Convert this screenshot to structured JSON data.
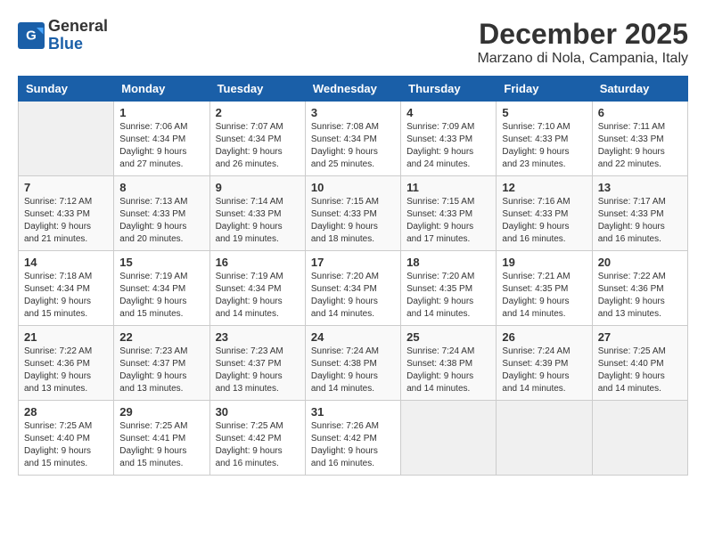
{
  "logo": {
    "general": "General",
    "blue": "Blue"
  },
  "title": "December 2025",
  "location": "Marzano di Nola, Campania, Italy",
  "days": [
    "Sunday",
    "Monday",
    "Tuesday",
    "Wednesday",
    "Thursday",
    "Friday",
    "Saturday"
  ],
  "weeks": [
    [
      {
        "day": "",
        "sunrise": "",
        "sunset": "",
        "daylight": ""
      },
      {
        "day": "1",
        "sunrise": "Sunrise: 7:06 AM",
        "sunset": "Sunset: 4:34 PM",
        "daylight": "Daylight: 9 hours and 27 minutes."
      },
      {
        "day": "2",
        "sunrise": "Sunrise: 7:07 AM",
        "sunset": "Sunset: 4:34 PM",
        "daylight": "Daylight: 9 hours and 26 minutes."
      },
      {
        "day": "3",
        "sunrise": "Sunrise: 7:08 AM",
        "sunset": "Sunset: 4:34 PM",
        "daylight": "Daylight: 9 hours and 25 minutes."
      },
      {
        "day": "4",
        "sunrise": "Sunrise: 7:09 AM",
        "sunset": "Sunset: 4:33 PM",
        "daylight": "Daylight: 9 hours and 24 minutes."
      },
      {
        "day": "5",
        "sunrise": "Sunrise: 7:10 AM",
        "sunset": "Sunset: 4:33 PM",
        "daylight": "Daylight: 9 hours and 23 minutes."
      },
      {
        "day": "6",
        "sunrise": "Sunrise: 7:11 AM",
        "sunset": "Sunset: 4:33 PM",
        "daylight": "Daylight: 9 hours and 22 minutes."
      }
    ],
    [
      {
        "day": "7",
        "sunrise": "Sunrise: 7:12 AM",
        "sunset": "Sunset: 4:33 PM",
        "daylight": "Daylight: 9 hours and 21 minutes."
      },
      {
        "day": "8",
        "sunrise": "Sunrise: 7:13 AM",
        "sunset": "Sunset: 4:33 PM",
        "daylight": "Daylight: 9 hours and 20 minutes."
      },
      {
        "day": "9",
        "sunrise": "Sunrise: 7:14 AM",
        "sunset": "Sunset: 4:33 PM",
        "daylight": "Daylight: 9 hours and 19 minutes."
      },
      {
        "day": "10",
        "sunrise": "Sunrise: 7:15 AM",
        "sunset": "Sunset: 4:33 PM",
        "daylight": "Daylight: 9 hours and 18 minutes."
      },
      {
        "day": "11",
        "sunrise": "Sunrise: 7:15 AM",
        "sunset": "Sunset: 4:33 PM",
        "daylight": "Daylight: 9 hours and 17 minutes."
      },
      {
        "day": "12",
        "sunrise": "Sunrise: 7:16 AM",
        "sunset": "Sunset: 4:33 PM",
        "daylight": "Daylight: 9 hours and 16 minutes."
      },
      {
        "day": "13",
        "sunrise": "Sunrise: 7:17 AM",
        "sunset": "Sunset: 4:33 PM",
        "daylight": "Daylight: 9 hours and 16 minutes."
      }
    ],
    [
      {
        "day": "14",
        "sunrise": "Sunrise: 7:18 AM",
        "sunset": "Sunset: 4:34 PM",
        "daylight": "Daylight: 9 hours and 15 minutes."
      },
      {
        "day": "15",
        "sunrise": "Sunrise: 7:19 AM",
        "sunset": "Sunset: 4:34 PM",
        "daylight": "Daylight: 9 hours and 15 minutes."
      },
      {
        "day": "16",
        "sunrise": "Sunrise: 7:19 AM",
        "sunset": "Sunset: 4:34 PM",
        "daylight": "Daylight: 9 hours and 14 minutes."
      },
      {
        "day": "17",
        "sunrise": "Sunrise: 7:20 AM",
        "sunset": "Sunset: 4:34 PM",
        "daylight": "Daylight: 9 hours and 14 minutes."
      },
      {
        "day": "18",
        "sunrise": "Sunrise: 7:20 AM",
        "sunset": "Sunset: 4:35 PM",
        "daylight": "Daylight: 9 hours and 14 minutes."
      },
      {
        "day": "19",
        "sunrise": "Sunrise: 7:21 AM",
        "sunset": "Sunset: 4:35 PM",
        "daylight": "Daylight: 9 hours and 14 minutes."
      },
      {
        "day": "20",
        "sunrise": "Sunrise: 7:22 AM",
        "sunset": "Sunset: 4:36 PM",
        "daylight": "Daylight: 9 hours and 13 minutes."
      }
    ],
    [
      {
        "day": "21",
        "sunrise": "Sunrise: 7:22 AM",
        "sunset": "Sunset: 4:36 PM",
        "daylight": "Daylight: 9 hours and 13 minutes."
      },
      {
        "day": "22",
        "sunrise": "Sunrise: 7:23 AM",
        "sunset": "Sunset: 4:37 PM",
        "daylight": "Daylight: 9 hours and 13 minutes."
      },
      {
        "day": "23",
        "sunrise": "Sunrise: 7:23 AM",
        "sunset": "Sunset: 4:37 PM",
        "daylight": "Daylight: 9 hours and 13 minutes."
      },
      {
        "day": "24",
        "sunrise": "Sunrise: 7:24 AM",
        "sunset": "Sunset: 4:38 PM",
        "daylight": "Daylight: 9 hours and 14 minutes."
      },
      {
        "day": "25",
        "sunrise": "Sunrise: 7:24 AM",
        "sunset": "Sunset: 4:38 PM",
        "daylight": "Daylight: 9 hours and 14 minutes."
      },
      {
        "day": "26",
        "sunrise": "Sunrise: 7:24 AM",
        "sunset": "Sunset: 4:39 PM",
        "daylight": "Daylight: 9 hours and 14 minutes."
      },
      {
        "day": "27",
        "sunrise": "Sunrise: 7:25 AM",
        "sunset": "Sunset: 4:40 PM",
        "daylight": "Daylight: 9 hours and 14 minutes."
      }
    ],
    [
      {
        "day": "28",
        "sunrise": "Sunrise: 7:25 AM",
        "sunset": "Sunset: 4:40 PM",
        "daylight": "Daylight: 9 hours and 15 minutes."
      },
      {
        "day": "29",
        "sunrise": "Sunrise: 7:25 AM",
        "sunset": "Sunset: 4:41 PM",
        "daylight": "Daylight: 9 hours and 15 minutes."
      },
      {
        "day": "30",
        "sunrise": "Sunrise: 7:25 AM",
        "sunset": "Sunset: 4:42 PM",
        "daylight": "Daylight: 9 hours and 16 minutes."
      },
      {
        "day": "31",
        "sunrise": "Sunrise: 7:26 AM",
        "sunset": "Sunset: 4:42 PM",
        "daylight": "Daylight: 9 hours and 16 minutes."
      },
      {
        "day": "",
        "sunrise": "",
        "sunset": "",
        "daylight": ""
      },
      {
        "day": "",
        "sunrise": "",
        "sunset": "",
        "daylight": ""
      },
      {
        "day": "",
        "sunrise": "",
        "sunset": "",
        "daylight": ""
      }
    ]
  ]
}
